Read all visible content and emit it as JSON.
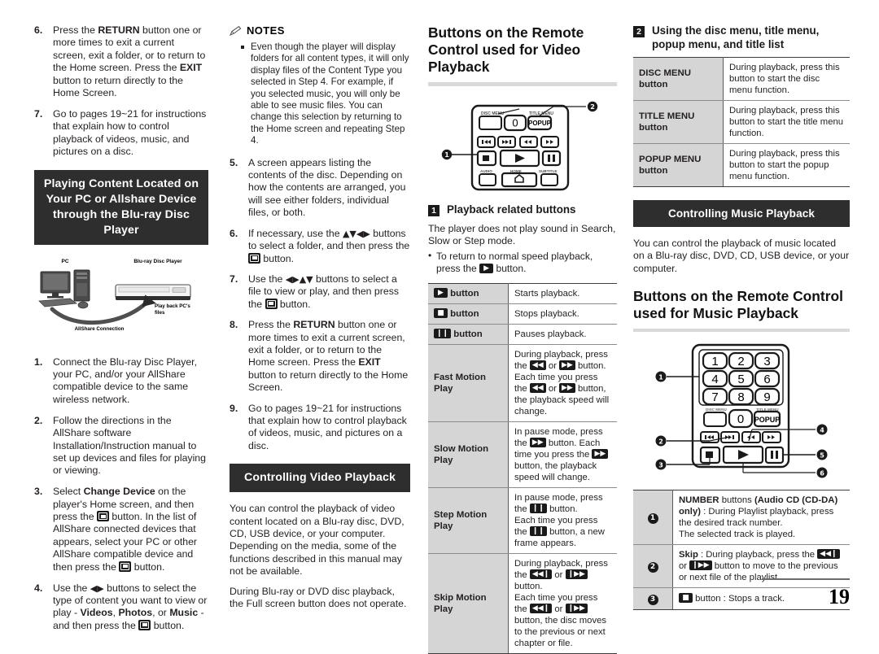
{
  "page": {
    "number": "19"
  },
  "col1": {
    "steps_top": [
      {
        "num": "6.",
        "html": "Press the <b>RETURN</b> button one or more times to exit a current screen, exit a folder, or to return to the Home screen. Press the <b>EXIT</b> button to return directly to the Home Screen."
      },
      {
        "num": "7.",
        "html": "Go to pages 19~21 for instructions that explain how to control playback of videos, music, and pictures on a disc."
      }
    ],
    "section_heading": "Playing Content Located on Your PC or Allshare Device through the Blu-ray Disc Player",
    "diagram": {
      "label_pc": "PC",
      "label_player": "Blu-ray Disc Player",
      "label_playback": "Play back PC's files",
      "label_connection": "AllShare Connection"
    },
    "steps_bottom": [
      {
        "num": "1.",
        "html": "Connect the Blu-ray Disc Player, your PC, and/or your AllShare compatible device to the same wireless network."
      },
      {
        "num": "2.",
        "html": "Follow the directions in the AllShare software Installation/Instruction manual to set up devices and files for playing or viewing."
      },
      {
        "num": "3.",
        "html": "Select <b>Change Device</b> on the player's Home screen, and then press the <ent></ent> button. In the list of AllShare connected devices that appears, select your PC or other AllShare compatible device and then press the <ent></ent> button."
      },
      {
        "num": "4.",
        "html": "Use the <arr>&#9664;&#9654;</arr> buttons to select the type of content you want to view or play - <b>Videos</b>, <b>Photos</b>, or <b>Music</b> - and then press the <ent></ent> button."
      }
    ]
  },
  "col2": {
    "notes_label": "NOTES",
    "notes": [
      "Even though the player will display folders for all content types, it will only display files of the Content Type you selected in Step 4. For example, if you selected music, you will only be able to see music files. You can change this selection by returning to the Home screen and repeating Step 4."
    ],
    "steps": [
      {
        "num": "5.",
        "html": "A screen appears listing the contents of the disc. Depending on how the contents are arranged, you will see either folders, individual files, or both."
      },
      {
        "num": "6.",
        "html": "If necessary, use the <arr>&#9650;&#9660;&#9664;&#9654;</arr> buttons to select a folder, and then press the <ent></ent> button."
      },
      {
        "num": "7.",
        "html": "Use the <arr>&#9664;&#9654;&#9650;&#9660;</arr> buttons to select a file to view or play, and then press the <ent></ent> button."
      },
      {
        "num": "8.",
        "html": "Press the <b>RETURN</b> button one or more times to exit a current screen, exit a folder, or to return to the Home screen. Press the <b>EXIT</b> button to return directly to the Home Screen."
      },
      {
        "num": "9.",
        "html": "Go to pages 19~21 for instructions that explain how to control playback of videos, music, and pictures on a disc."
      }
    ],
    "bar_heading": "Controlling Video Playback",
    "body_paragraphs": [
      "You can control the playback of video content located on a Blu-ray disc, DVD, CD, USB device, or your computer. Depending on the media, some of the functions described in this manual may not be available.",
      "During Blu-ray or DVD disc playback, the Full screen button does not operate."
    ]
  },
  "col3": {
    "title": "Buttons on the Remote Control used for Video Playback",
    "remote": {
      "label_disc_menu": "DISC MENU",
      "label_title_menu": "TITLE MENU",
      "label_popup": "POPUP",
      "label_zero": "0",
      "label_audio": "AUDIO",
      "label_home": "HOME",
      "label_subtitle": "SUBTITLE",
      "callout1": "1",
      "callout2": "2"
    },
    "numhead": {
      "num": "1",
      "title": "Playback related buttons"
    },
    "intro": "The player does not play sound in Search, Slow or Step mode.",
    "bullets": [
      {
        "html": "To return to normal speed playback, press the <chip>&#9654;</chip> button."
      }
    ],
    "table": [
      {
        "key_html": "<chip>&#9654;</chip> button",
        "val_html": "Starts playback."
      },
      {
        "key_html": "<chip>&#9632;</chip> button",
        "val_html": "Stops playback."
      },
      {
        "key_html": "<chip>&#10073;&#10073;</chip> button",
        "val_html": "Pauses playback."
      },
      {
        "key_html": "Fast Motion Play",
        "val_html": "During playback, press the <chip>&#9664;&#9664;</chip> or <chip>&#9654;&#9654;</chip> button.<br>Each time you press the <chip>&#9664;&#9664;</chip> or <chip>&#9654;&#9654;</chip> button, the playback speed will change."
      },
      {
        "key_html": "Slow Motion Play",
        "val_html": "In pause mode, press the <chip>&#9654;&#9654;</chip> button. Each time you press the <chip>&#9654;&#9654;</chip> button, the playback speed will change."
      },
      {
        "key_html": "Step Motion Play",
        "val_html": "In pause mode, press the <chip>&#10073;&#10073;</chip> button.<br>Each time you press the <chip>&#10073;&#10073;</chip> button, a new frame appears."
      },
      {
        "key_html": "Skip Motion Play",
        "val_html": "During playback, press the <chip>&#9664;&#9664;&#10073;</chip> or <chip>&#10073;&#9654;&#9654;</chip> button.<br>Each time you press the <chip>&#9664;&#9664;&#10073;</chip> or <chip>&#10073;&#9654;&#9654;</chip> button, the disc moves to the previous or next chapter or file."
      }
    ]
  },
  "col4": {
    "numhead": {
      "num": "2",
      "title": "Using the disc menu, title menu, popup menu, and title list"
    },
    "menu_table": [
      {
        "key": "DISC MENU button",
        "val": "During playback, press this button to start the disc menu function."
      },
      {
        "key": "TITLE MENU button",
        "val": "During playback, press this button to start the title menu function."
      },
      {
        "key": "POPUP MENU button",
        "val": "During playback, press this button to start the popup menu function."
      }
    ],
    "bar_heading": "Controlling Music Playback",
    "intro": "You can control the playback of music located on a Blu-ray disc, DVD, CD, USB device, or your computer.",
    "title": "Buttons on the Remote Control used for Music Playback",
    "remote": {
      "keys": [
        "1",
        "2",
        "3",
        "4",
        "5",
        "6",
        "7",
        "8",
        "9"
      ],
      "label_zero": "0",
      "label_disc_menu": "DISC MENU",
      "label_title_menu": "TITLE MENU",
      "label_popup": "POPUP",
      "callouts": [
        "1",
        "2",
        "3",
        "4",
        "5",
        "6"
      ]
    },
    "num_table": [
      {
        "key": "1",
        "val_html": "<b>NUMBER</b> buttons <b>(Audio CD (CD-DA) only)</b> : During Playlist playback, press the desired track number.<br>The selected track is played."
      },
      {
        "key": "2",
        "val_html": "<b>Skip</b> : During playback, press the <chip>&#9664;&#9664;&#10073;</chip> or <chip>&#10073;&#9654;&#9654;</chip> button to move to the previous or next file of the playlist."
      },
      {
        "key": "3",
        "val_html": "<chip>&#9632;</chip> button : Stops a track."
      }
    ]
  }
}
